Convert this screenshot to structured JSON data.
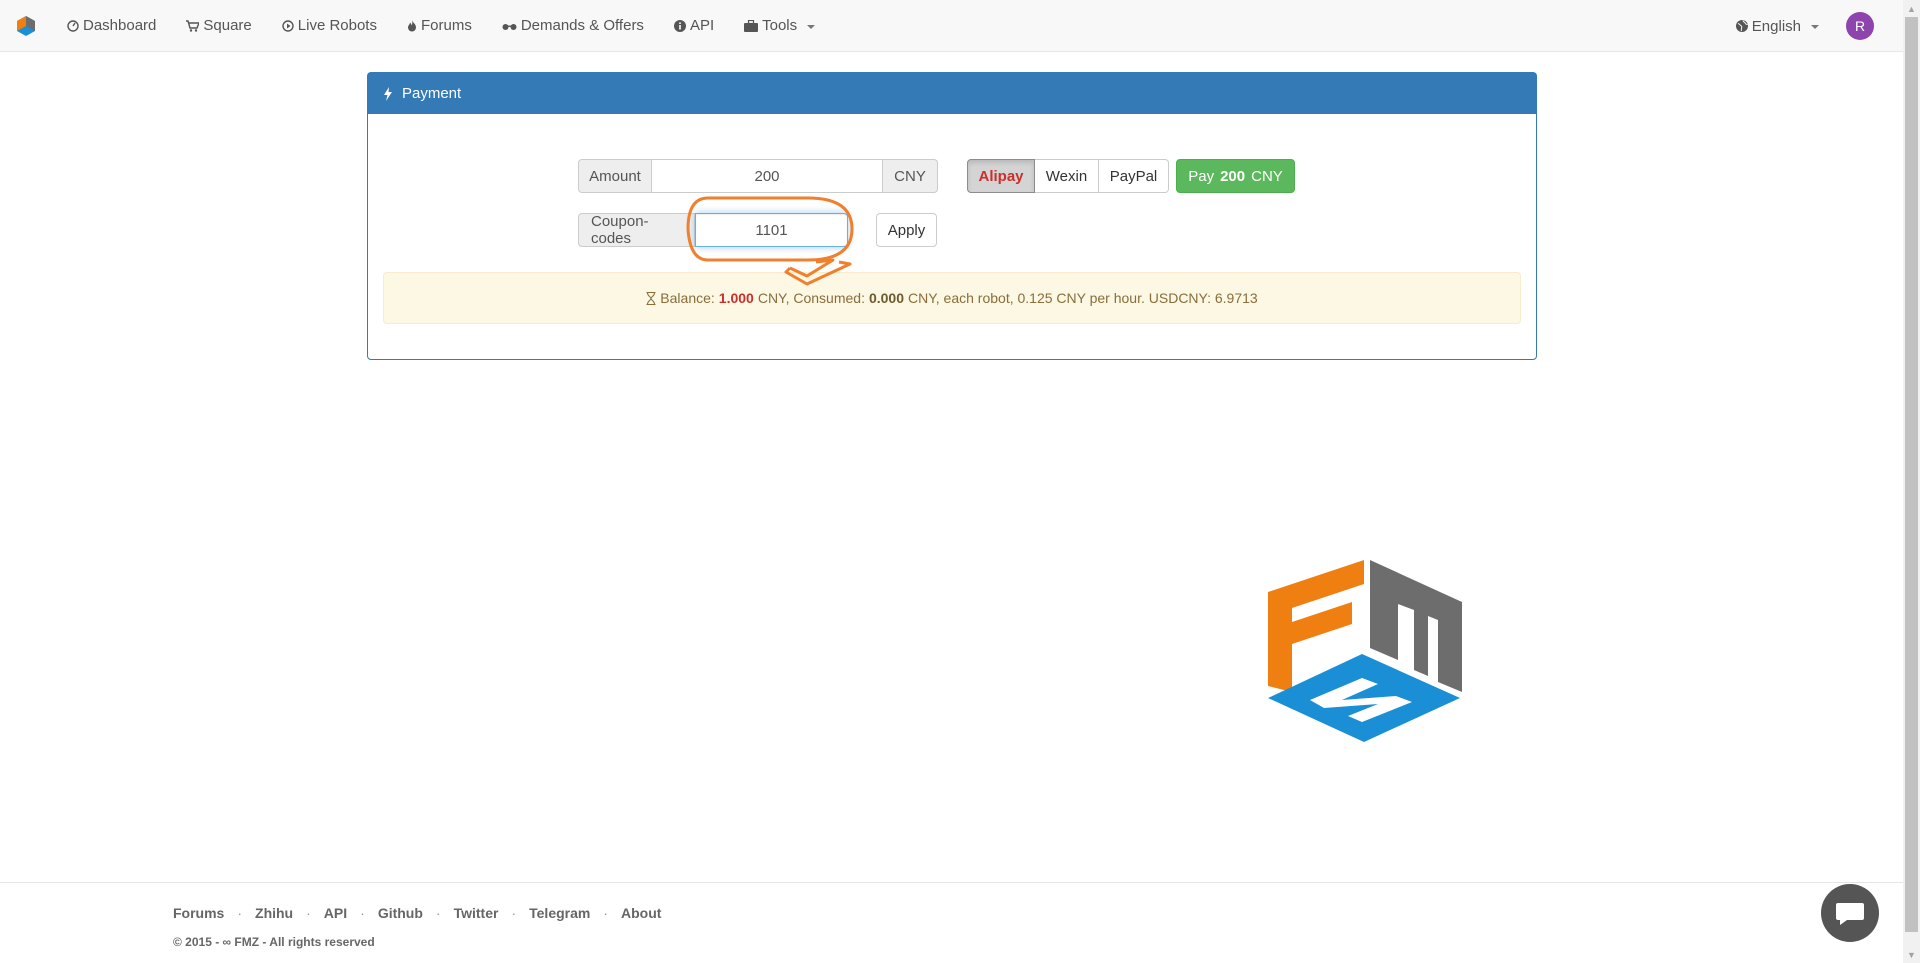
{
  "nav": {
    "items": [
      {
        "label": "Dashboard",
        "icon": "dashboard-icon"
      },
      {
        "label": "Square",
        "icon": "cart-icon"
      },
      {
        "label": "Live Robots",
        "icon": "play-circle-icon"
      },
      {
        "label": "Forums",
        "icon": "fire-icon"
      },
      {
        "label": "Demands & Offers",
        "icon": "glasses-icon"
      },
      {
        "label": "API",
        "icon": "info-icon"
      },
      {
        "label": "Tools",
        "icon": "briefcase-icon"
      }
    ],
    "language": "English",
    "avatar_initial": "R"
  },
  "payment": {
    "title": "Payment",
    "amount_label": "Amount",
    "amount_value": "200",
    "currency": "CNY",
    "methods": [
      "Alipay",
      "Wexin",
      "PayPal"
    ],
    "selected_method": "Alipay",
    "pay_prefix": "Pay",
    "pay_amount": "200",
    "pay_currency": "CNY",
    "coupon_label": "Coupon-codes",
    "coupon_value": "1101",
    "apply_label": "Apply"
  },
  "balance": {
    "balance_label": "Balance:",
    "balance_value": "1.000",
    "balance_unit": "CNY, Consumed:",
    "consumed_value": "0.000",
    "rest": "CNY, each robot, 0.125 CNY per hour. USDCNY: 6.9713"
  },
  "footer": {
    "links": [
      "Forums",
      "Zhihu",
      "API",
      "Github",
      "Twitter",
      "Telegram",
      "About"
    ],
    "copyright": "© 2015 - ∞ FMZ - All rights reserved"
  },
  "colors": {
    "primary": "#337ab7",
    "success": "#5cb85c",
    "annotation": "#f07f2e",
    "logo_orange": "#f07f12",
    "logo_gray": "#6d6d6d",
    "logo_blue": "#1a8fd6"
  }
}
